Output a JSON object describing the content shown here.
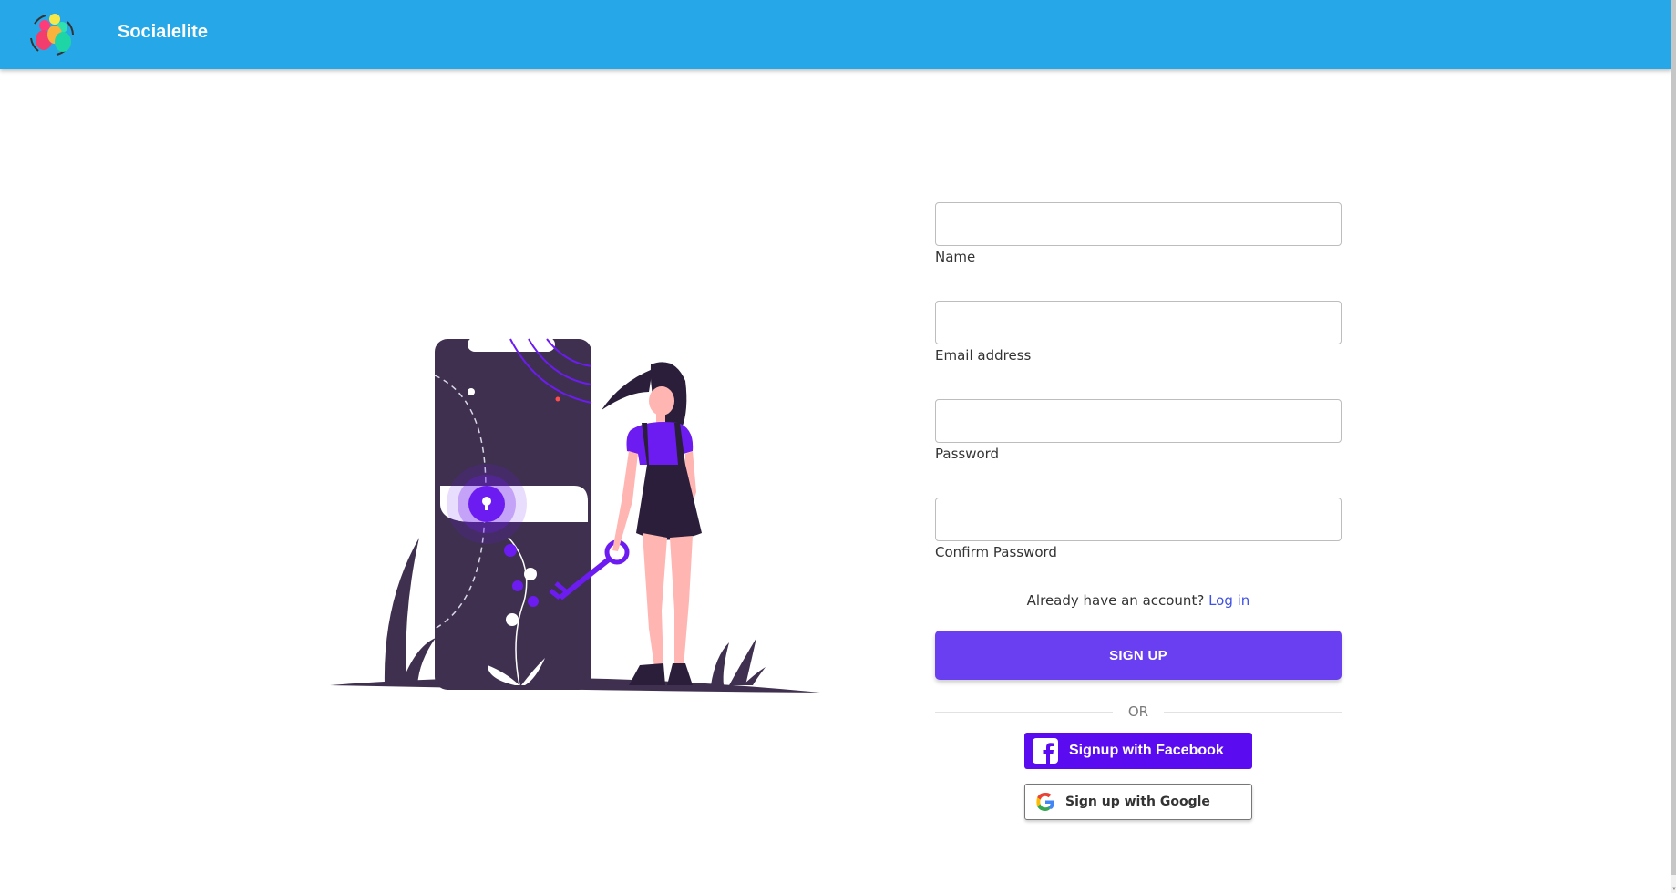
{
  "app": {
    "name": "Socialelite"
  },
  "form": {
    "fields": [
      {
        "label": "Name",
        "value": ""
      },
      {
        "label": "Email address",
        "value": ""
      },
      {
        "label": "Password",
        "value": ""
      },
      {
        "label": "Confirm Password",
        "value": ""
      }
    ],
    "login_prompt": "Already have an account?",
    "login_link": "Log in",
    "signup_label": "SIGN UP",
    "divider_label": "OR",
    "facebook_label": "Signup with Facebook",
    "google_label": "Sign up with Google"
  },
  "colors": {
    "navbar": "#26a8e8",
    "primary": "#6a3ff2",
    "facebook": "#5b0bf0",
    "illustration_dark": "#3f3050",
    "illustration_accent": "#6c1cf0"
  },
  "icons": {
    "logo": "socialelite-logo-icon",
    "facebook": "facebook-icon",
    "google": "google-icon",
    "illustration": "unlock-phone-illustration"
  }
}
